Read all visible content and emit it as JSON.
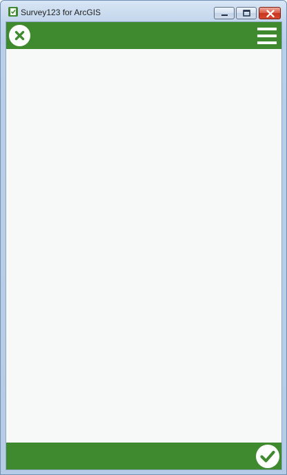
{
  "window": {
    "title": "Survey123 for ArcGIS",
    "app_icon": "survey123-icon",
    "controls": {
      "minimize_icon": "minimize-icon",
      "maximize_icon": "maximize-icon",
      "close_icon": "close-icon"
    }
  },
  "app": {
    "top_bar": {
      "close_icon": "close-circle-icon",
      "menu_icon": "hamburger-menu-icon"
    },
    "bottom_bar": {
      "submit_icon": "checkmark-circle-icon"
    }
  },
  "colors": {
    "accent": "#3f8a2f",
    "content_background": "#f7f8f8",
    "icon_foreground": "#ffffff"
  }
}
